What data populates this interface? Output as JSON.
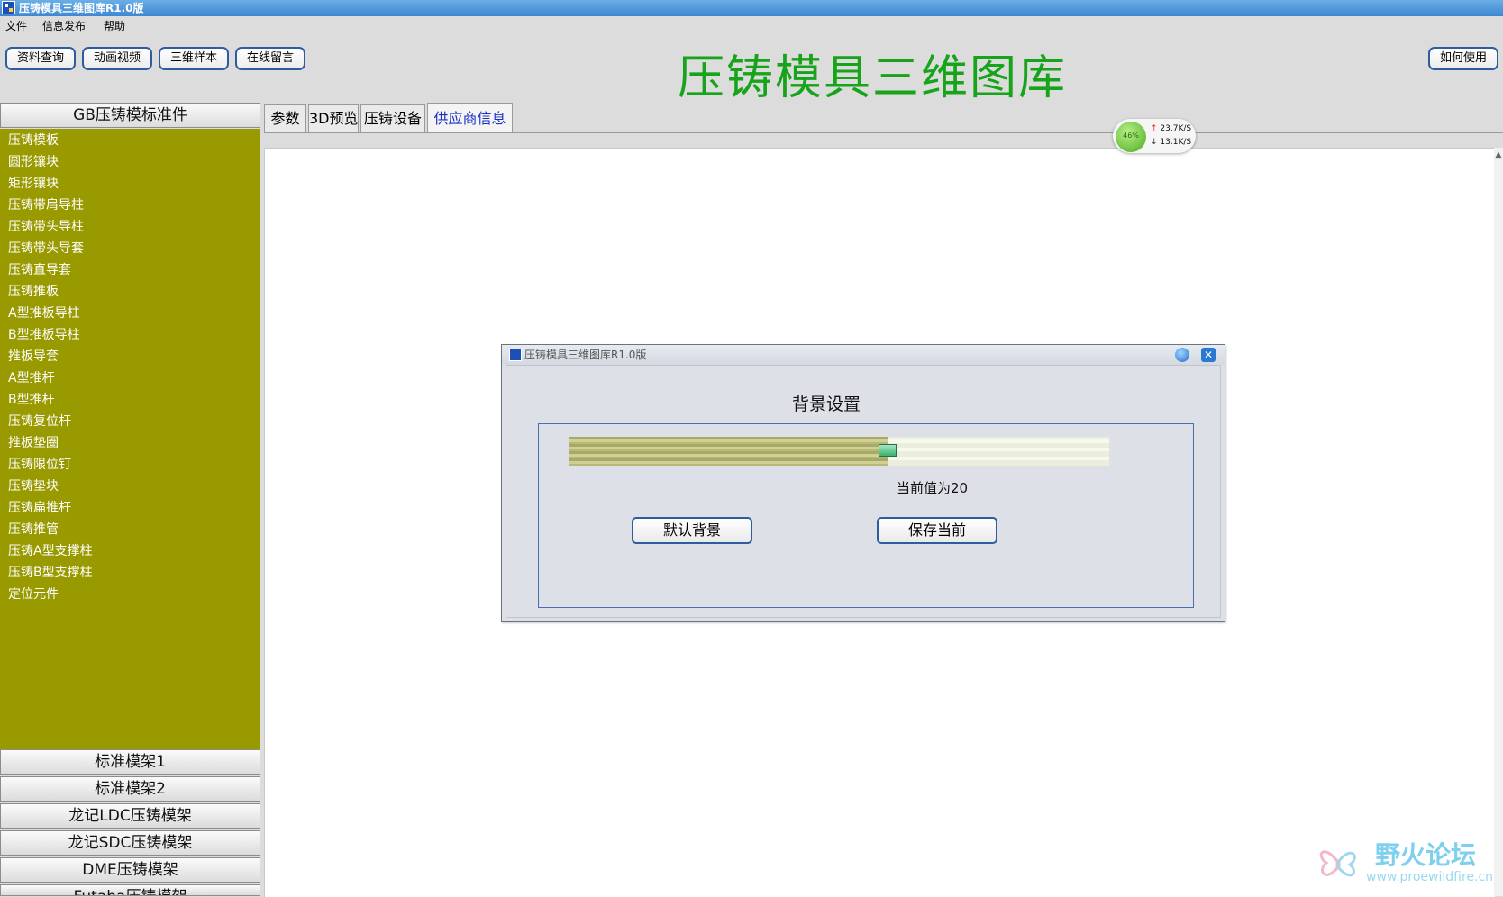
{
  "window": {
    "title": "压铸模具三维图库R1.0版"
  },
  "menu": [
    "文件",
    "信息发布",
    "帮助"
  ],
  "toolbar": {
    "buttons": [
      "资料查询",
      "动画视频",
      "三维样本",
      "在线留言"
    ],
    "help_button": "如何使用"
  },
  "app_title": "压铸模具三维图库",
  "sidebar": {
    "groups": [
      {
        "label": "GB压铸模标准件",
        "expanded": true
      },
      {
        "label": "标准模架1"
      },
      {
        "label": "标准模架2"
      },
      {
        "label": "龙记LDC压铸模架"
      },
      {
        "label": "龙记SDC压铸模架"
      },
      {
        "label": "DME压铸模架"
      },
      {
        "label": "Futaba压铸模架"
      }
    ],
    "items": [
      "压铸模板",
      "圆形镶块",
      "矩形镶块",
      "压铸带肩导柱",
      "压铸带头导柱",
      "压铸带头导套",
      "压铸直导套",
      "压铸推板",
      "A型推板导柱",
      "B型推板导柱",
      "推板导套",
      "A型推杆",
      "B型推杆",
      "压铸复位杆",
      "推板垫圈",
      "压铸限位钉",
      "压铸垫块",
      "压铸扁推杆",
      "压铸推管",
      "压铸A型支撑柱",
      "压铸B型支撑柱",
      "定位元件"
    ],
    "panel_color": "#999900"
  },
  "tabs": [
    {
      "label": "参数"
    },
    {
      "label": "3D预览"
    },
    {
      "label": "压铸设备"
    },
    {
      "label": "供应商信息",
      "active": true
    }
  ],
  "net_monitor": {
    "percent": "46%",
    "upload": "23.7K/S",
    "download": "13.1K/S"
  },
  "dialog": {
    "title": "压铸模具三维图库R1.0版",
    "group_label": "背景设置",
    "slider_fraction": 0.59,
    "value_text": "当前值为20",
    "buttons": [
      "默认背景",
      "保存当前"
    ]
  },
  "watermark": {
    "name": "野火论坛",
    "url": "www.proewildfire.cn"
  }
}
